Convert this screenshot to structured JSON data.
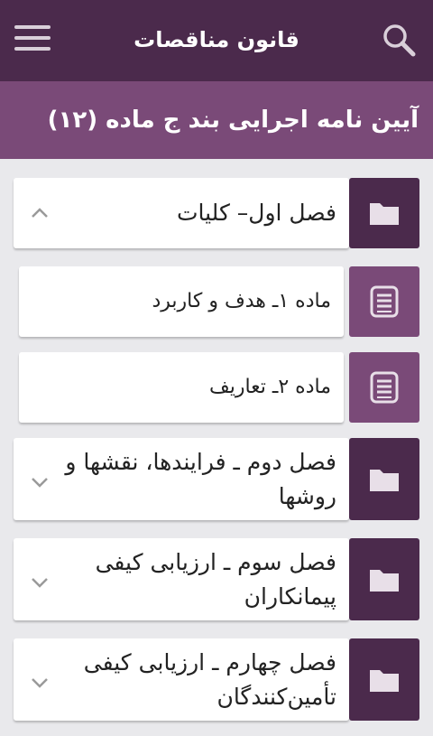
{
  "app_bar": {
    "title": "قانون مناقصات",
    "menu_icon": "hamburger-menu-icon",
    "search_icon": "search-icon",
    "background": "#4b2a4c"
  },
  "sub_header": {
    "title": "آیین نامه اجرایی بند ج ماده (۱۲)",
    "background": "#7a4a78"
  },
  "items": [
    {
      "type": "chapter",
      "label": "فصل اول– کلیات",
      "icon": "folder-icon",
      "expanded": true
    },
    {
      "type": "article",
      "label": "ماده ۱ـ هدف و کاربرد",
      "icon": "document-icon"
    },
    {
      "type": "article",
      "label": "ماده ۲ـ تعاریف",
      "icon": "document-icon"
    },
    {
      "type": "chapter",
      "label": "فصل دوم ـ فرایندها، نقشها و روشها",
      "icon": "folder-icon",
      "expanded": false
    },
    {
      "type": "chapter",
      "label": "فصل سوم ـ ارزیابی کیفی پیمانکاران",
      "icon": "folder-icon",
      "expanded": false
    },
    {
      "type": "chapter",
      "label": "فصل چهارم ـ ارزیابی کیفی تأمین‌کنندگان",
      "icon": "folder-icon",
      "expanded": false
    }
  ]
}
